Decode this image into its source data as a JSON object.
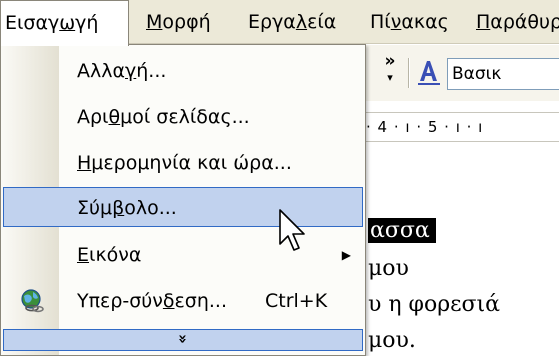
{
  "menubar": {
    "items": [
      {
        "label": "Εισαγωγή",
        "pre": "Εισαγ",
        "u": "ω",
        "post": "γή",
        "open": true
      },
      {
        "label": "Μορφή",
        "pre": "",
        "u": "Μ",
        "post": "ορφή"
      },
      {
        "label": "Εργαλεία",
        "pre": "Εργα",
        "u": "λ",
        "post": "εία"
      },
      {
        "label": "Πίνακας",
        "pre": "Πί",
        "u": "ν",
        "post": "ακας"
      },
      {
        "label": "Παράθυρ",
        "pre": "",
        "u": "Π",
        "post": "αράθυρ"
      }
    ]
  },
  "menu": {
    "items": [
      {
        "label": "Αλλαγή...",
        "pre": "Αλλα",
        "u": "γ",
        "post": "ή..."
      },
      {
        "label": "Αριθμοί σελίδας...",
        "pre": "Αρι",
        "u": "θ",
        "post": "μοί σελίδας..."
      },
      {
        "label": "Ημερομηνία και ώρα...",
        "pre": "",
        "u": "Η",
        "post": "μερομηνία και ώρα..."
      },
      {
        "label": "Σύμβολο...",
        "pre": "Σύμ",
        "u": "β",
        "post": "ολο...",
        "hover": true
      },
      {
        "label": "Εικόνα",
        "pre": "",
        "u": "Ε",
        "post": "ικόνα",
        "submenu": true
      },
      {
        "label": "Υπερ-σύνδεση...",
        "pre": "Υπερ-σύν",
        "u": "δ",
        "post": "εση...",
        "shortcut": "Ctrl+K",
        "icon": "globe-link-icon"
      }
    ],
    "expand_glyph": "»"
  },
  "toolbar": {
    "style_box_text": "Βασικ",
    "ruler_text": "· 4 · ı · 5 · ı · ı"
  },
  "document": {
    "lines": [
      "ασσα",
      "μου",
      "υ η φορεσιά",
      "μου."
    ]
  },
  "colors": {
    "menubar_bg": "#ece9d8",
    "highlight_bg": "#c1d2ee",
    "highlight_border": "#316ac5"
  }
}
